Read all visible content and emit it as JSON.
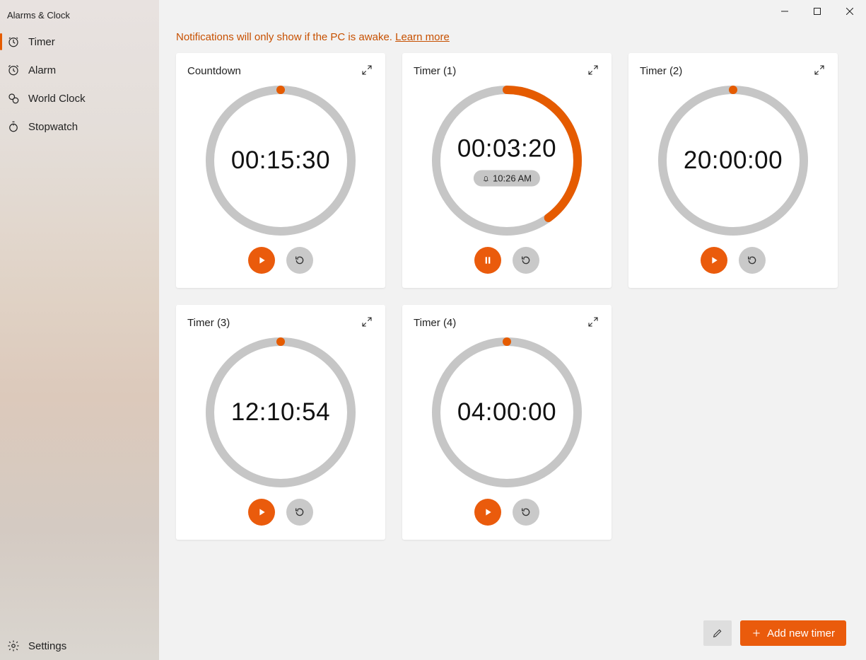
{
  "app_title": "Alarms & Clock",
  "nav": {
    "timer": "Timer",
    "alarm": "Alarm",
    "world_clock": "World Clock",
    "stopwatch": "Stopwatch",
    "settings": "Settings"
  },
  "notice": {
    "text": "Notifications will only show if the PC is awake. ",
    "link": "Learn more"
  },
  "timers": [
    {
      "name": "Countdown",
      "time": "00:15:30",
      "progress": 0,
      "state": "play",
      "bell": null
    },
    {
      "name": "Timer (1)",
      "time": "00:03:20",
      "progress": 0.4,
      "state": "pause",
      "bell": "10:26 AM"
    },
    {
      "name": "Timer (2)",
      "time": "20:00:00",
      "progress": 0,
      "state": "play",
      "bell": null
    },
    {
      "name": "Timer (3)",
      "time": "12:10:54",
      "progress": 0,
      "state": "play",
      "bell": null
    },
    {
      "name": "Timer (4)",
      "time": "04:00:00",
      "progress": 0,
      "state": "play",
      "bell": null
    }
  ],
  "buttons": {
    "add_timer": "Add new timer"
  }
}
